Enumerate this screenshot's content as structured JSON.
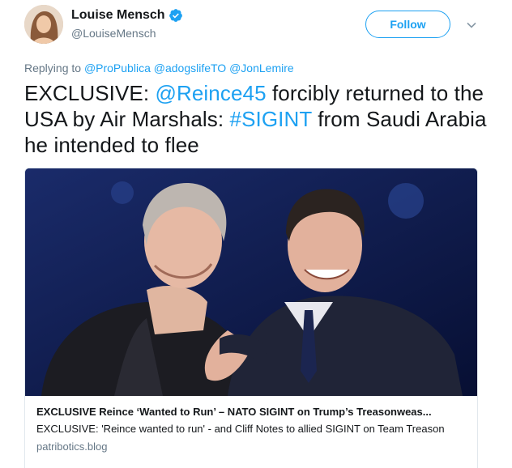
{
  "user": {
    "display_name": "Louise Mensch",
    "handle": "@LouiseMensch",
    "verified_icon": "verified-badge-icon"
  },
  "actions": {
    "follow_label": "Follow",
    "more_icon": "chevron-down-icon"
  },
  "reply": {
    "prefix": "Replying to",
    "mentions": [
      "@ProPublica",
      "@adogslifeTO",
      "@JonLemire"
    ]
  },
  "tweet": {
    "part1": "EXCLUSIVE: ",
    "mention": "@Reince45",
    "part2": " forcibly returned to the USA by Air Marshals: ",
    "hashtag": "#SIGINT",
    "part3": " from Saudi Arabia he intended to flee"
  },
  "card": {
    "title": "EXCLUSIVE Reince ‘Wanted to Run’ – NATO SIGINT on Trump’s Treasonweas...",
    "description": "EXCLUSIVE: 'Reince wanted to run' - and Cliff Notes to allied SIGINT on Team Treason",
    "domain": "patribotics.blog"
  },
  "colors": {
    "accent": "#1da1f2",
    "text": "#14171a",
    "muted": "#657786",
    "border": "#e1e8ed"
  }
}
